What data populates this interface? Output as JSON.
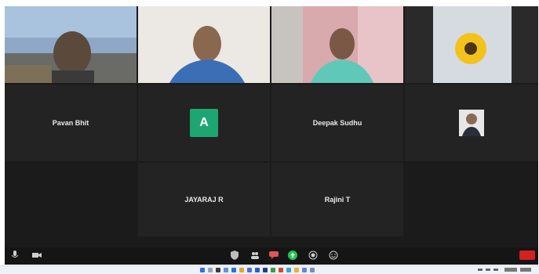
{
  "participants": [
    {
      "id": "p1",
      "name": "",
      "caption": ""
    },
    {
      "id": "p2",
      "name": "",
      "caption": ""
    },
    {
      "id": "p3",
      "name": "",
      "caption": ""
    },
    {
      "id": "p4",
      "name": "",
      "caption": ""
    },
    {
      "id": "p5",
      "name": "Pavan Bhit",
      "caption": ""
    },
    {
      "id": "p6",
      "name": "",
      "avatar_letter": "A",
      "caption": ""
    },
    {
      "id": "p7",
      "name": "Deepak Sudhu",
      "caption": ""
    },
    {
      "id": "p8",
      "name": "",
      "caption": ""
    },
    {
      "id": "p9",
      "name": "JAYARAJ R",
      "caption": ""
    },
    {
      "id": "p10",
      "name": "Rajini T",
      "caption": ""
    }
  ],
  "controls": {
    "end_label": ""
  },
  "colors": {
    "meeting_bg": "#1b1b1b",
    "tile_bg": "#232323",
    "avatar_green": "#1ea672",
    "end_red": "#d32020",
    "taskbar_bg": "#eef1f7"
  }
}
